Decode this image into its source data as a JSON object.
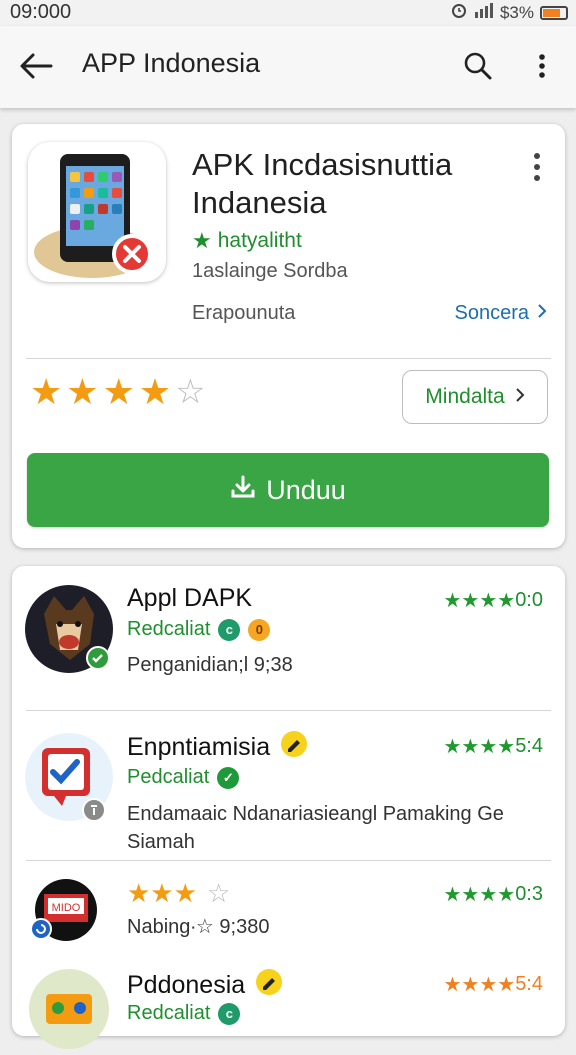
{
  "status": {
    "time": "09:000",
    "battery": "$3%",
    "battery_level": 0.75
  },
  "appbar": {
    "title": "APP Indonesia"
  },
  "app": {
    "title_line1": "APK Incdasisnuttia",
    "title_line2": "Indanesia",
    "developer": "hatyalitht",
    "subtitle": "1aslainge Sordba",
    "category": "Erapounuta",
    "link_label": "Soncera",
    "rating_stars": 4.5,
    "secondary_button": "Mindalta",
    "download_button": "Unduu"
  },
  "list": [
    {
      "title": "Appl DAPK",
      "subtitle": "Redcaliat",
      "badge": "0",
      "meta": "Penganidian;l 9;38",
      "rating": "0:0",
      "rating_color": "#1f9a2e"
    },
    {
      "title": "Enpntiamisia",
      "subtitle": "Pedcaliat",
      "meta_line1": "Endamaaic Ndanariasieangl Pamaking Ge",
      "meta_line2": "Siamah",
      "rating": "5:4",
      "rating_color": "#1f9a2e"
    },
    {
      "title_stars": 3,
      "meta": "Nabing∙☆ 9;380",
      "rating": "0:3",
      "rating_color": "#1f9a2e"
    },
    {
      "title": "Pddonesia",
      "subtitle": "Redcaliat",
      "rating": "5:4",
      "rating_color": "#f08020"
    }
  ],
  "colors": {
    "green": "#3aa544",
    "star_orange": "#f39c12",
    "link_blue": "#1a6fb0"
  }
}
